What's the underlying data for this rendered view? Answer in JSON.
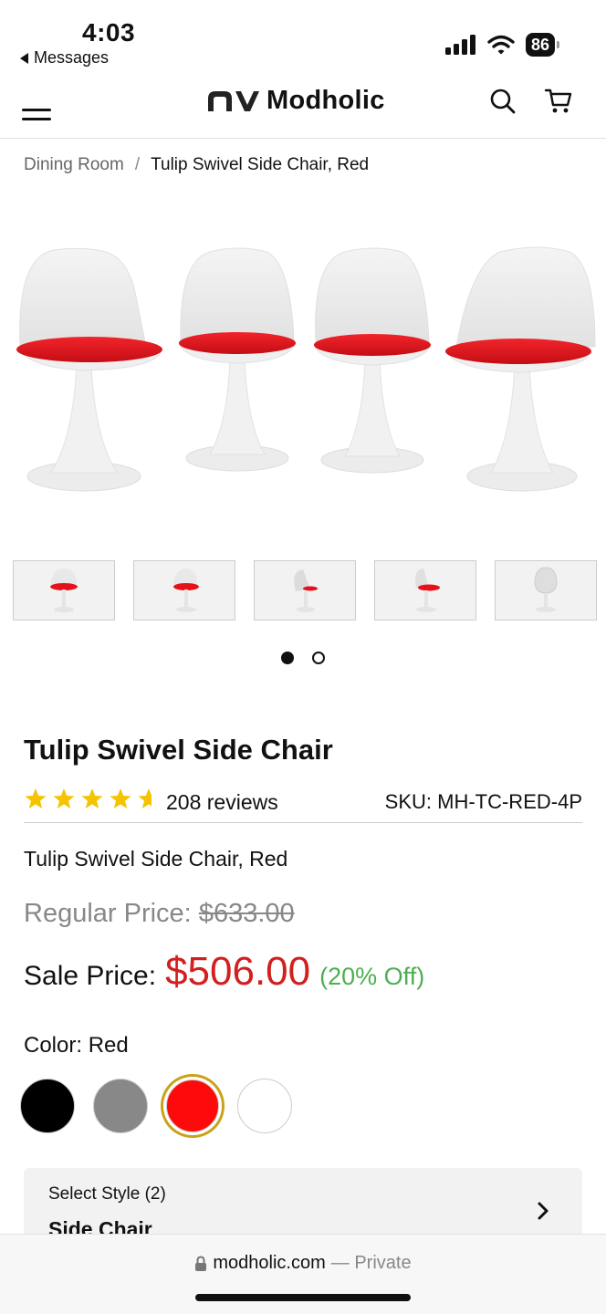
{
  "status": {
    "time": "4:03",
    "back_label": "Messages",
    "battery": "86"
  },
  "header": {
    "logo_text": "Modholic"
  },
  "breadcrumb": {
    "parent": "Dining Room",
    "separator": "/",
    "current": "Tulip Swivel Side Chair, Red"
  },
  "gallery": {
    "chair_seat_color": "#e3121b",
    "thumb_count": 5,
    "page_count": 2,
    "active_page": 1
  },
  "product": {
    "title": "Tulip Swivel Side Chair",
    "rating": 5,
    "reviews": "208 reviews",
    "sku": "SKU: MH-TC-RED-4P",
    "variant_name": "Tulip Swivel Side Chair, Red",
    "regular_label": "Regular Price:",
    "regular_price": "$633.00",
    "sale_label": "Sale Price:",
    "sale_price": "$506.00",
    "discount": "(20% Off)",
    "color_label": "Color: Red",
    "swatches": [
      "#000000",
      "#888888",
      "#ff0a0a",
      "#ffffff"
    ],
    "selected_swatch": "#ff0a0a",
    "style_label": "Select Style (2)",
    "style_value": "Side Chair"
  },
  "browser": {
    "domain": "modholic.com",
    "mode": "— Private"
  },
  "colors": {
    "sale_red": "#d21f1f",
    "discount_green": "#4caf50",
    "star_yellow": "#f5c400",
    "selected_ring": "#c9a21a"
  }
}
